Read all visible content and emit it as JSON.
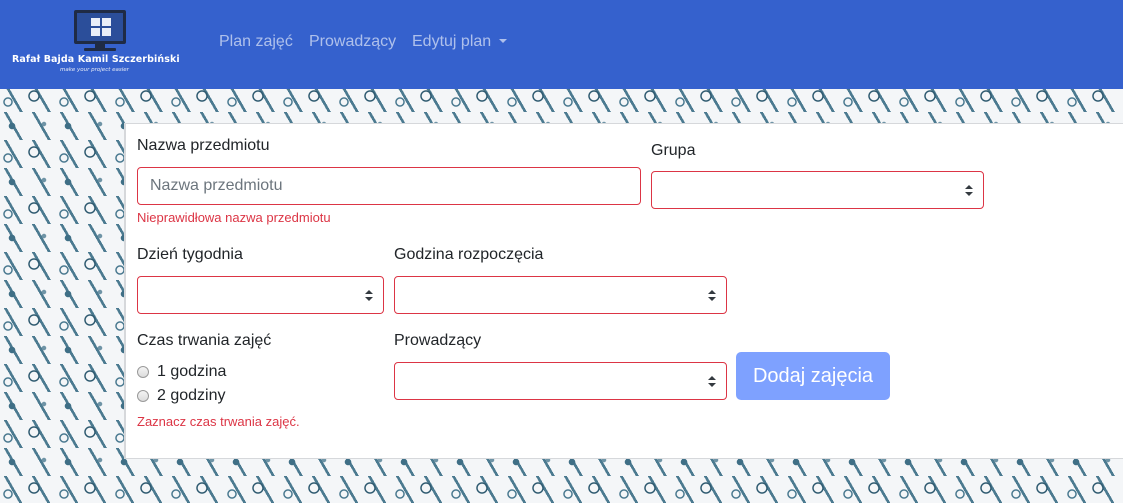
{
  "brand": {
    "name": "Rafał Bajda Kamil Szczerbiński",
    "tagline": "make your project easier",
    "logo_icon": "windows-monitor-icon"
  },
  "nav": {
    "items": [
      {
        "label": "Plan zajęć"
      },
      {
        "label": "Prowadzący"
      },
      {
        "label": "Edytuj plan",
        "dropdown": true
      }
    ]
  },
  "form": {
    "subject": {
      "label": "Nazwa przedmiotu",
      "placeholder": "Nazwa przedmiotu",
      "value": "",
      "error": "Nieprawidłowa nazwa przedmiotu"
    },
    "group": {
      "label": "Grupa",
      "selected": ""
    },
    "weekday": {
      "label": "Dzień tygodnia",
      "selected": ""
    },
    "start_time": {
      "label": "Godzina rozpoczęcia",
      "selected": ""
    },
    "duration": {
      "label": "Czas trwania zajęć",
      "options": [
        {
          "label": "1 godzina",
          "checked": false
        },
        {
          "label": "2 godziny",
          "checked": false
        }
      ],
      "error": "Zaznacz czas trwania zajęć."
    },
    "teacher": {
      "label": "Prowadzący",
      "selected": ""
    },
    "submit_label": "Dodaj zajęcia"
  },
  "colors": {
    "navbar": "#3561cd",
    "error": "#dc3545",
    "button_disabled": "#7ea1ff",
    "nav_link": "rgba(255,255,255,0.6)"
  }
}
